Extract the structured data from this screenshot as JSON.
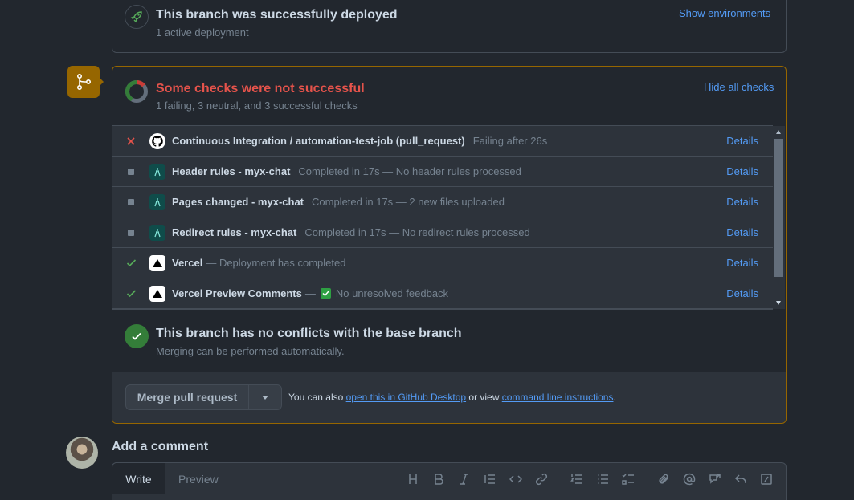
{
  "deployment": {
    "title": "This branch was successfully deployed",
    "subtitle": "1 active deployment",
    "link": "Show environments"
  },
  "checks": {
    "title": "Some checks were not successful",
    "subtitle": "1 failing, 3 neutral, and 3 successful checks",
    "toggle": "Hide all checks",
    "items": [
      {
        "status": "failing",
        "avatar": "github",
        "name": "Continuous Integration / automation-test-job (pull_request)",
        "desc": "Failing after 26s",
        "details": "Details"
      },
      {
        "status": "neutral",
        "avatar": "cloudflare",
        "name": "Header rules - myx-chat",
        "desc": "Completed in 17s — No header rules processed",
        "details": "Details"
      },
      {
        "status": "neutral",
        "avatar": "cloudflare",
        "name": "Pages changed - myx-chat",
        "desc": "Completed in 17s — 2 new files uploaded",
        "details": "Details"
      },
      {
        "status": "neutral",
        "avatar": "cloudflare",
        "name": "Redirect rules - myx-chat",
        "desc": "Completed in 17s — No redirect rules processed",
        "details": "Details"
      },
      {
        "status": "success",
        "avatar": "vercel",
        "name": "Vercel",
        "desc": "— Deployment has completed",
        "details": "Details"
      },
      {
        "status": "success",
        "avatar": "vercel",
        "name": "Vercel Preview Comments",
        "desc": "—",
        "desc2": "No unresolved feedback",
        "details": "Details"
      }
    ]
  },
  "conflicts": {
    "title": "This branch has no conflicts with the base branch",
    "subtitle": "Merging can be performed automatically."
  },
  "merge": {
    "button": "Merge pull request",
    "note_prefix": "You can also",
    "desktop_link": "open this in GitHub Desktop",
    "note_mid": "or view",
    "cli_link": "command line instructions",
    "note_suffix": "."
  },
  "comment": {
    "title": "Add a comment",
    "tab_write": "Write",
    "tab_preview": "Preview"
  },
  "colors": {
    "failing": "#e5534b",
    "warning": "#966600",
    "success": "#57ab5a",
    "accent": "#539bf5"
  }
}
